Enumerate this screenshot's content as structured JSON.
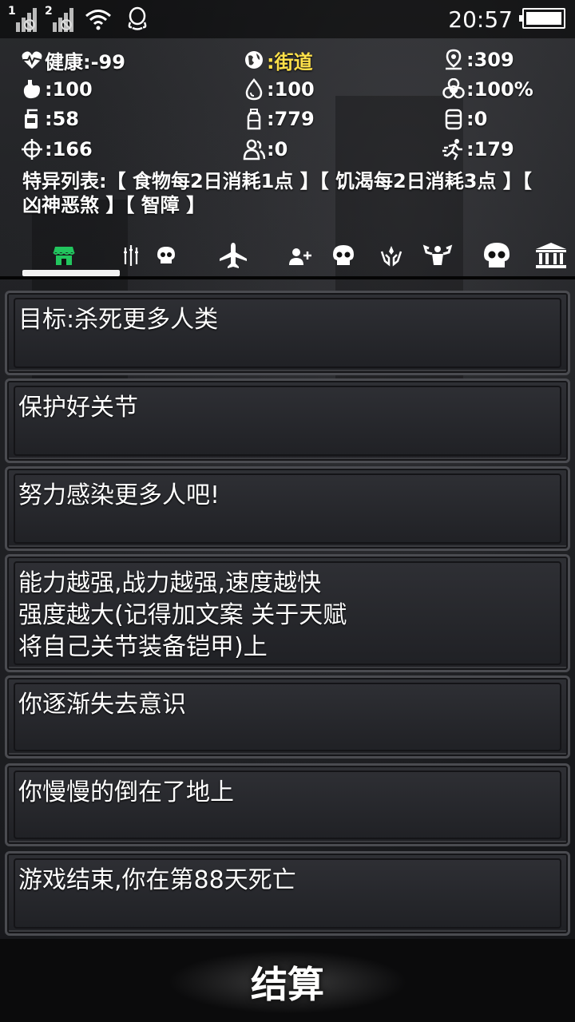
{
  "status_bar": {
    "sim1": "1",
    "sim2": "2",
    "time": "20:57",
    "icons": [
      "signal-sim1-icon",
      "signal-sim2-icon",
      "wifi-icon",
      "qq-icon",
      "battery-icon"
    ]
  },
  "stats": {
    "health": "健康:-99",
    "location": ":街道",
    "distance": ":309",
    "stomach": ":100",
    "water": ":100",
    "infection": ":100%",
    "food": ":58",
    "bottle": ":779",
    "item": ":0",
    "attack": ":166",
    "people": ":0",
    "speed": ":179",
    "highlight_color": "#ffe14a"
  },
  "traits_text": "特异列表:【 食物每2日消耗1点 】【 饥渴每2日消耗3点 】【 凶神恶煞 】【 智障 】",
  "tabs": [
    {
      "icon": "shop-icon",
      "active": true,
      "color": "#22c55e"
    },
    {
      "icon": "weapons-icon"
    },
    {
      "icon": "skull-small-icon"
    },
    {
      "icon": "airplane-icon"
    },
    {
      "icon": "add-person-icon"
    },
    {
      "icon": "skull-icon"
    },
    {
      "icon": "hands-icon"
    },
    {
      "icon": "muscle-icon"
    },
    {
      "icon": "skull-large-icon"
    },
    {
      "icon": "bank-icon"
    }
  ],
  "messages": [
    "目标:杀死更多人类",
    "保护好关节",
    "努力感染更多人吧!",
    "能力越强,战力越强,速度越快\n强度越大(记得加文案 关于天赋\n将自己关节装备铠甲)上",
    "你逐渐失去意识",
    "你慢慢的倒在了地上",
    "游戏结束,你在第88天死亡"
  ],
  "settle_button": "结算"
}
